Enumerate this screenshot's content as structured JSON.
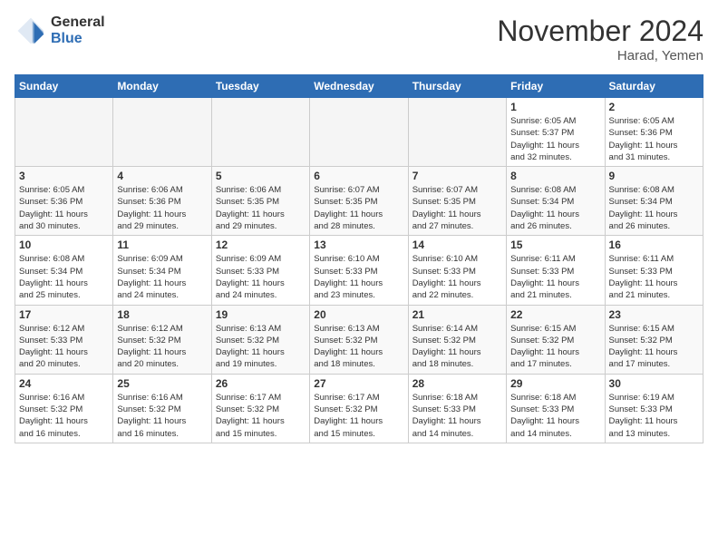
{
  "logo": {
    "general": "General",
    "blue": "Blue"
  },
  "header": {
    "month": "November 2024",
    "location": "Harad, Yemen"
  },
  "weekdays": [
    "Sunday",
    "Monday",
    "Tuesday",
    "Wednesday",
    "Thursday",
    "Friday",
    "Saturday"
  ],
  "weeks": [
    [
      {
        "day": "",
        "info": ""
      },
      {
        "day": "",
        "info": ""
      },
      {
        "day": "",
        "info": ""
      },
      {
        "day": "",
        "info": ""
      },
      {
        "day": "",
        "info": ""
      },
      {
        "day": "1",
        "info": "Sunrise: 6:05 AM\nSunset: 5:37 PM\nDaylight: 11 hours\nand 32 minutes."
      },
      {
        "day": "2",
        "info": "Sunrise: 6:05 AM\nSunset: 5:36 PM\nDaylight: 11 hours\nand 31 minutes."
      }
    ],
    [
      {
        "day": "3",
        "info": "Sunrise: 6:05 AM\nSunset: 5:36 PM\nDaylight: 11 hours\nand 30 minutes."
      },
      {
        "day": "4",
        "info": "Sunrise: 6:06 AM\nSunset: 5:36 PM\nDaylight: 11 hours\nand 29 minutes."
      },
      {
        "day": "5",
        "info": "Sunrise: 6:06 AM\nSunset: 5:35 PM\nDaylight: 11 hours\nand 29 minutes."
      },
      {
        "day": "6",
        "info": "Sunrise: 6:07 AM\nSunset: 5:35 PM\nDaylight: 11 hours\nand 28 minutes."
      },
      {
        "day": "7",
        "info": "Sunrise: 6:07 AM\nSunset: 5:35 PM\nDaylight: 11 hours\nand 27 minutes."
      },
      {
        "day": "8",
        "info": "Sunrise: 6:08 AM\nSunset: 5:34 PM\nDaylight: 11 hours\nand 26 minutes."
      },
      {
        "day": "9",
        "info": "Sunrise: 6:08 AM\nSunset: 5:34 PM\nDaylight: 11 hours\nand 26 minutes."
      }
    ],
    [
      {
        "day": "10",
        "info": "Sunrise: 6:08 AM\nSunset: 5:34 PM\nDaylight: 11 hours\nand 25 minutes."
      },
      {
        "day": "11",
        "info": "Sunrise: 6:09 AM\nSunset: 5:34 PM\nDaylight: 11 hours\nand 24 minutes."
      },
      {
        "day": "12",
        "info": "Sunrise: 6:09 AM\nSunset: 5:33 PM\nDaylight: 11 hours\nand 24 minutes."
      },
      {
        "day": "13",
        "info": "Sunrise: 6:10 AM\nSunset: 5:33 PM\nDaylight: 11 hours\nand 23 minutes."
      },
      {
        "day": "14",
        "info": "Sunrise: 6:10 AM\nSunset: 5:33 PM\nDaylight: 11 hours\nand 22 minutes."
      },
      {
        "day": "15",
        "info": "Sunrise: 6:11 AM\nSunset: 5:33 PM\nDaylight: 11 hours\nand 21 minutes."
      },
      {
        "day": "16",
        "info": "Sunrise: 6:11 AM\nSunset: 5:33 PM\nDaylight: 11 hours\nand 21 minutes."
      }
    ],
    [
      {
        "day": "17",
        "info": "Sunrise: 6:12 AM\nSunset: 5:33 PM\nDaylight: 11 hours\nand 20 minutes."
      },
      {
        "day": "18",
        "info": "Sunrise: 6:12 AM\nSunset: 5:32 PM\nDaylight: 11 hours\nand 20 minutes."
      },
      {
        "day": "19",
        "info": "Sunrise: 6:13 AM\nSunset: 5:32 PM\nDaylight: 11 hours\nand 19 minutes."
      },
      {
        "day": "20",
        "info": "Sunrise: 6:13 AM\nSunset: 5:32 PM\nDaylight: 11 hours\nand 18 minutes."
      },
      {
        "day": "21",
        "info": "Sunrise: 6:14 AM\nSunset: 5:32 PM\nDaylight: 11 hours\nand 18 minutes."
      },
      {
        "day": "22",
        "info": "Sunrise: 6:15 AM\nSunset: 5:32 PM\nDaylight: 11 hours\nand 17 minutes."
      },
      {
        "day": "23",
        "info": "Sunrise: 6:15 AM\nSunset: 5:32 PM\nDaylight: 11 hours\nand 17 minutes."
      }
    ],
    [
      {
        "day": "24",
        "info": "Sunrise: 6:16 AM\nSunset: 5:32 PM\nDaylight: 11 hours\nand 16 minutes."
      },
      {
        "day": "25",
        "info": "Sunrise: 6:16 AM\nSunset: 5:32 PM\nDaylight: 11 hours\nand 16 minutes."
      },
      {
        "day": "26",
        "info": "Sunrise: 6:17 AM\nSunset: 5:32 PM\nDaylight: 11 hours\nand 15 minutes."
      },
      {
        "day": "27",
        "info": "Sunrise: 6:17 AM\nSunset: 5:32 PM\nDaylight: 11 hours\nand 15 minutes."
      },
      {
        "day": "28",
        "info": "Sunrise: 6:18 AM\nSunset: 5:33 PM\nDaylight: 11 hours\nand 14 minutes."
      },
      {
        "day": "29",
        "info": "Sunrise: 6:18 AM\nSunset: 5:33 PM\nDaylight: 11 hours\nand 14 minutes."
      },
      {
        "day": "30",
        "info": "Sunrise: 6:19 AM\nSunset: 5:33 PM\nDaylight: 11 hours\nand 13 minutes."
      }
    ]
  ]
}
